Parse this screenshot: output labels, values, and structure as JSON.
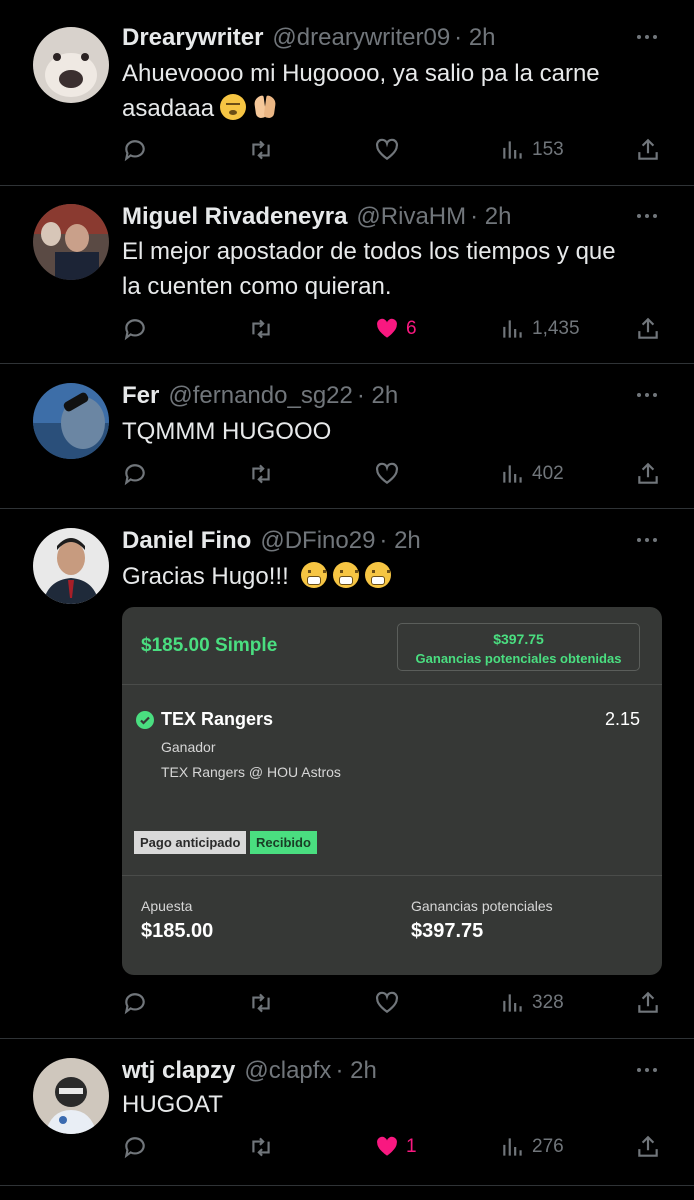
{
  "colors": {
    "background": "#000000",
    "text": "#e7e9ea",
    "muted": "#71767b",
    "like": "#f91880",
    "divider": "#2f3336",
    "bet_green": "#4ade80",
    "card_bg": "#363836"
  },
  "tweets": [
    {
      "name": "Drearywriter",
      "handle": "@drearywriter09",
      "time": "· 2h",
      "text_line1": "Ahuevoooo mi Hugoooo, ya salio pa la carne",
      "text_line2": "asadaaa",
      "emojis": [
        "relieved-face-emoji",
        "folded-hands-emoji"
      ],
      "replies": "",
      "retweets": "",
      "likes": "",
      "views": "153",
      "liked": false
    },
    {
      "name": "Miguel Rivadeneyra",
      "handle": "@RivaHM",
      "time": "· 2h",
      "text_line1": "El mejor apostador de todos los tiempos y que",
      "text_line2": "la cuenten como quieran.",
      "replies": "",
      "retweets": "",
      "likes": "6",
      "views": "1,435",
      "liked": true
    },
    {
      "name": "Fer",
      "handle": "@fernando_sg22",
      "time": "· 2h",
      "text_line1": "TQMMM HUGOOO",
      "replies": "",
      "retweets": "",
      "likes": "",
      "views": "402",
      "liked": false
    },
    {
      "name": "Daniel Fino",
      "handle": "@DFino29",
      "time": "· 2h",
      "text_line1": "Gracias Hugo!!!",
      "emojis": [
        "grimacing-face-emoji",
        "grimacing-face-emoji",
        "grimacing-face-emoji"
      ],
      "replies": "",
      "retweets": "",
      "likes": "",
      "views": "328",
      "liked": false,
      "bet_card": {
        "stake_title": "$185.00 Simple",
        "potential_value": "$397.75",
        "potential_label": "Ganancias potenciales obtenidas",
        "team": "TEX Rangers",
        "odds": "2.15",
        "result": "Ganador",
        "match": "TEX Rangers @ HOU Astros",
        "badge_early_payout": "Pago anticipado",
        "badge_received": "Recibido",
        "stake_label": "Apuesta",
        "stake_value": "$185.00",
        "winnings_label": "Ganancias potenciales",
        "winnings_value": "$397.75"
      }
    },
    {
      "name": "wtj clapzy",
      "handle": "@clapfx",
      "time": "· 2h",
      "text_line1": "HUGOAT",
      "replies": "",
      "retweets": "",
      "likes": "1",
      "views": "276",
      "liked": true
    }
  ]
}
